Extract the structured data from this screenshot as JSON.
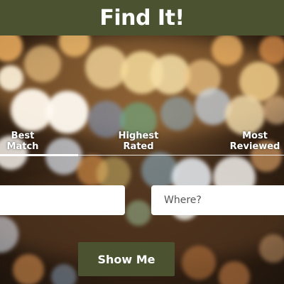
{
  "header": {
    "title": "Find It!"
  },
  "sort_tabs": [
    {
      "label": "Best\nMatch",
      "active": true
    },
    {
      "label": "Highest\nRated",
      "active": false
    },
    {
      "label": "Most\nReviewed",
      "active": false
    }
  ],
  "search": {
    "what_value": "",
    "where_placeholder": "Where?"
  },
  "submit": {
    "label": "Show Me"
  },
  "colors": {
    "brand": "#4a5230",
    "text_light": "#ffffff"
  }
}
